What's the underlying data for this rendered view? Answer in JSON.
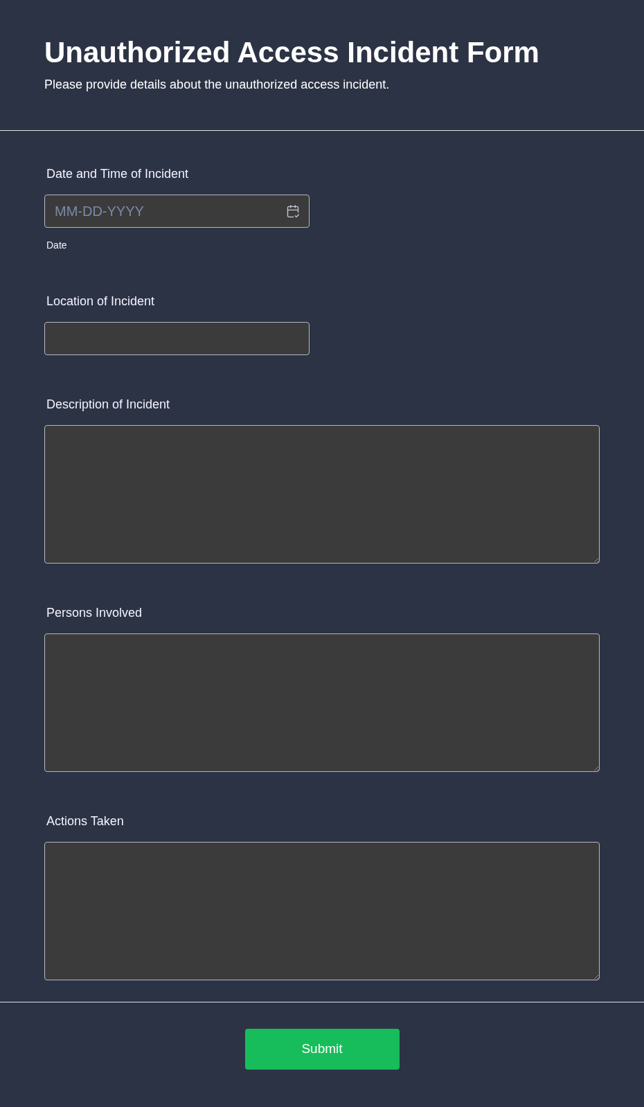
{
  "header": {
    "title": "Unauthorized Access Incident Form",
    "subtitle": "Please provide details about the unauthorized access incident."
  },
  "fields": [
    {
      "kind": "date",
      "label": "Date and Time of Incident",
      "placeholder": "MM-DD-YYYY",
      "sublabel": "Date"
    },
    {
      "kind": "text",
      "label": "Location of Incident"
    },
    {
      "kind": "textarea",
      "label": "Description of Incident"
    },
    {
      "kind": "textarea",
      "label": "Persons Involved"
    },
    {
      "kind": "textarea",
      "label": "Actions Taken"
    }
  ],
  "submit_button": "Submit"
}
